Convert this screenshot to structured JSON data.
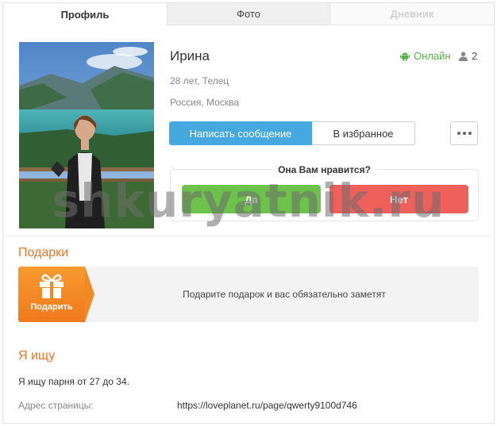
{
  "tabs": {
    "profile": "Профиль",
    "photo": "Фото",
    "diary": "Дневник"
  },
  "profile": {
    "name": "Ирина",
    "age_sign": "28 лет, Телец",
    "location": "Россия, Москва",
    "status": "Онлайн",
    "likes_count": "2"
  },
  "actions": {
    "message": "Написать сообщение",
    "favorite": "В избранное"
  },
  "like_widget": {
    "question": "Она Вам нравится?",
    "yes": "Да",
    "no": "Нет"
  },
  "watermark": "shkuryatnik.ru",
  "gifts": {
    "title": "Подарки",
    "button": "Подарить",
    "text": "Подарите подарок и вас обязательно заметят"
  },
  "search": {
    "title": "Я ищу",
    "text": "Я ищу парня от 27 до 34."
  },
  "address": {
    "label": "Адрес страницы:",
    "value": "https://loveplanet.ru/page/qwerty9100d746"
  },
  "colors": {
    "accent_orange": "#e4772b",
    "online_green": "#55b04a",
    "message_blue": "#45a9df",
    "yes_green": "#6cc24a",
    "no_red": "#f0605a"
  },
  "icons": {
    "status": "android-icon",
    "likes": "person-icon",
    "more": "more-dots-icon",
    "gift": "gift-icon"
  }
}
